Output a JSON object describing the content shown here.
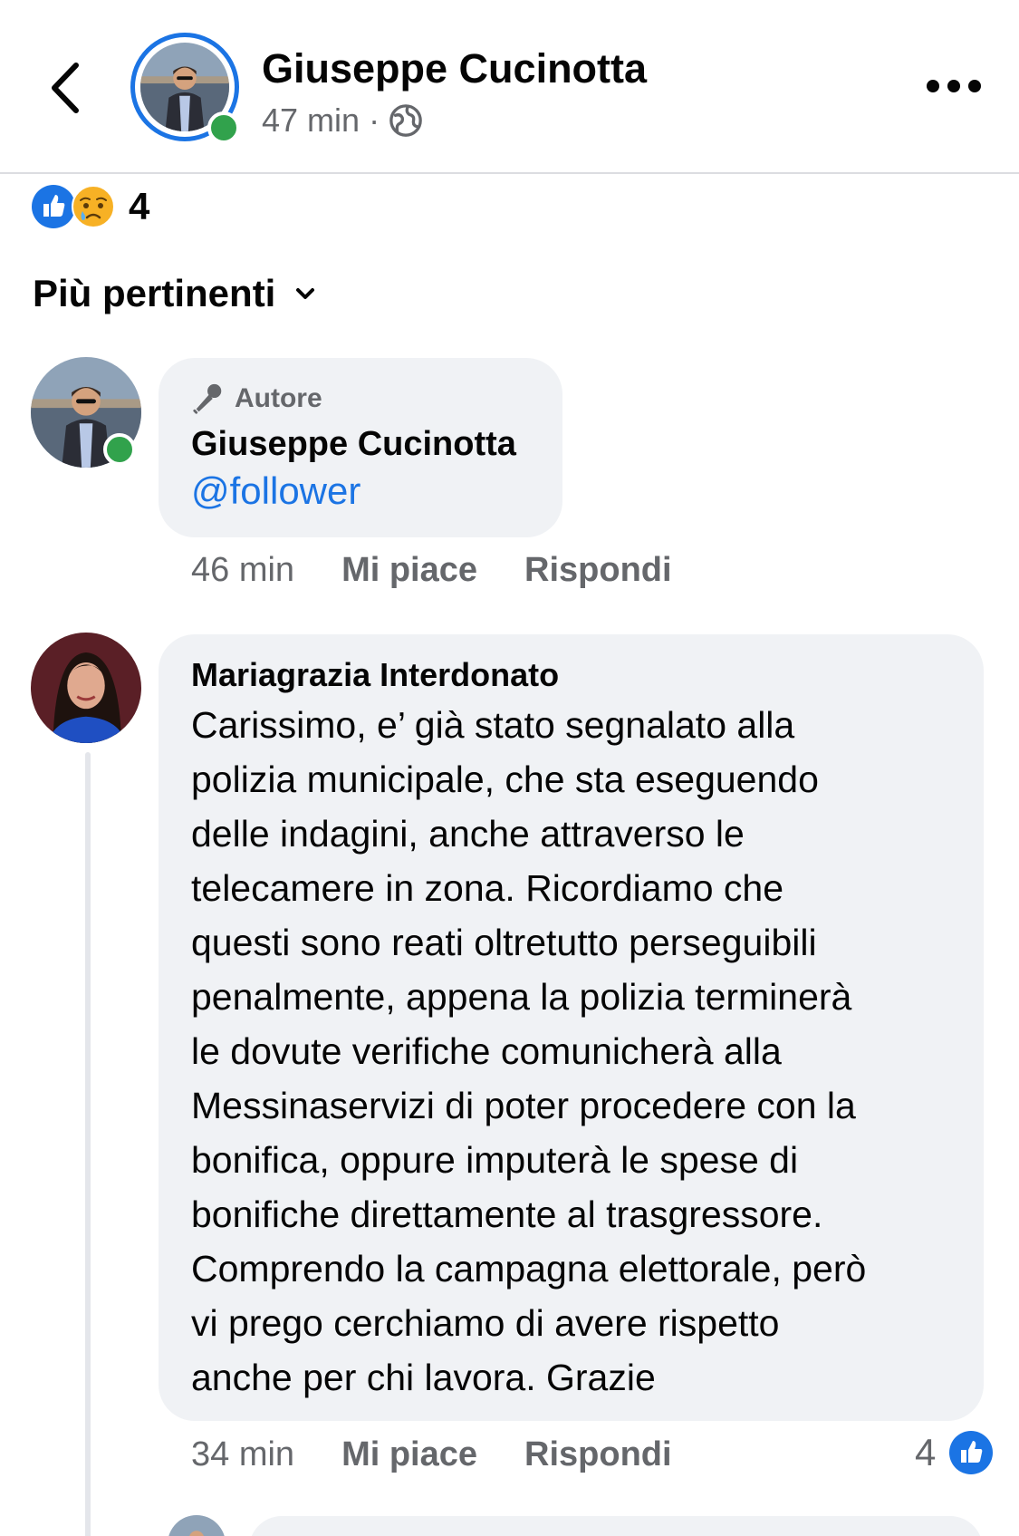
{
  "header": {
    "name": "Giuseppe Cucinotta",
    "time": "47 min",
    "separator": "·",
    "privacy_icon": "globe-icon"
  },
  "reactions": {
    "icons": [
      "like-reaction-icon",
      "sad-reaction-icon"
    ],
    "count": "4"
  },
  "sort": {
    "label": "Più pertinenti",
    "icon": "chevron-down-icon"
  },
  "comments": [
    {
      "badge": "Autore",
      "badge_icon": "microphone-icon",
      "author": "Giuseppe Cucinotta",
      "mention": "@follower",
      "time": "46 min",
      "like_label": "Mi piace",
      "reply_label": "Rispondi"
    },
    {
      "author": "Mariagrazia Interdonato",
      "text_lines": [
        "Carissimo, e’ già stato segnalato alla",
        "polizia municipale, che sta eseguendo",
        "delle indagini, anche attraverso le",
        "telecamere in zona. Ricordiamo che",
        "questi sono reati oltretutto perseguibili",
        "penalmente, appena la polizia terminerà",
        "le dovute verifiche comunicherà alla",
        "Messinaservizi di poter procedere con la",
        "bonifica, oppure imputerà le spese di",
        "bonifiche direttamente al trasgressore.",
        "Comprendo la campagna elettorale, però",
        "vi prego cerchiamo di avere rispetto",
        "anche per chi lavora. Grazie"
      ],
      "time": "34 min",
      "like_label": "Mi piace",
      "reply_label": "Rispondi",
      "like_count": "4"
    }
  ],
  "colors": {
    "accent": "#1b74e4",
    "online": "#31a24c",
    "bubble": "#f0f2f5",
    "secondary_text": "#65676b"
  }
}
